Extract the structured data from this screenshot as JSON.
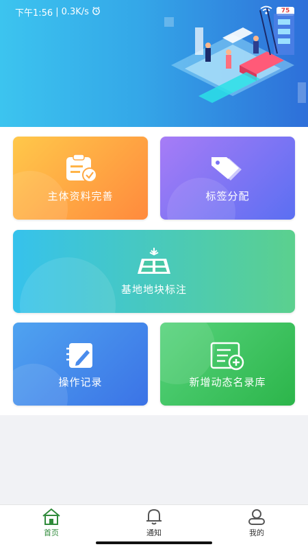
{
  "status_bar": {
    "time": "下午1:56",
    "speed": "0.3K/s",
    "battery": "75"
  },
  "cards": [
    {
      "label": "主体资料完善",
      "icon": "clipboard-check-icon"
    },
    {
      "label": "标签分配",
      "icon": "tags-icon"
    },
    {
      "label": "基地地块标注",
      "icon": "field-plots-icon"
    },
    {
      "label": "操作记录",
      "icon": "notebook-pen-icon"
    },
    {
      "label": "新增动态名录库",
      "icon": "document-add-icon"
    }
  ],
  "tabs": [
    {
      "label": "首页",
      "icon": "home-icon",
      "active": true
    },
    {
      "label": "通知",
      "icon": "bell-icon",
      "active": false
    },
    {
      "label": "我的",
      "icon": "user-icon",
      "active": false
    }
  ],
  "colors": {
    "active_tab": "#2f8a3a",
    "banner_start": "#3cc4ef",
    "banner_end": "#2e6fd9"
  }
}
